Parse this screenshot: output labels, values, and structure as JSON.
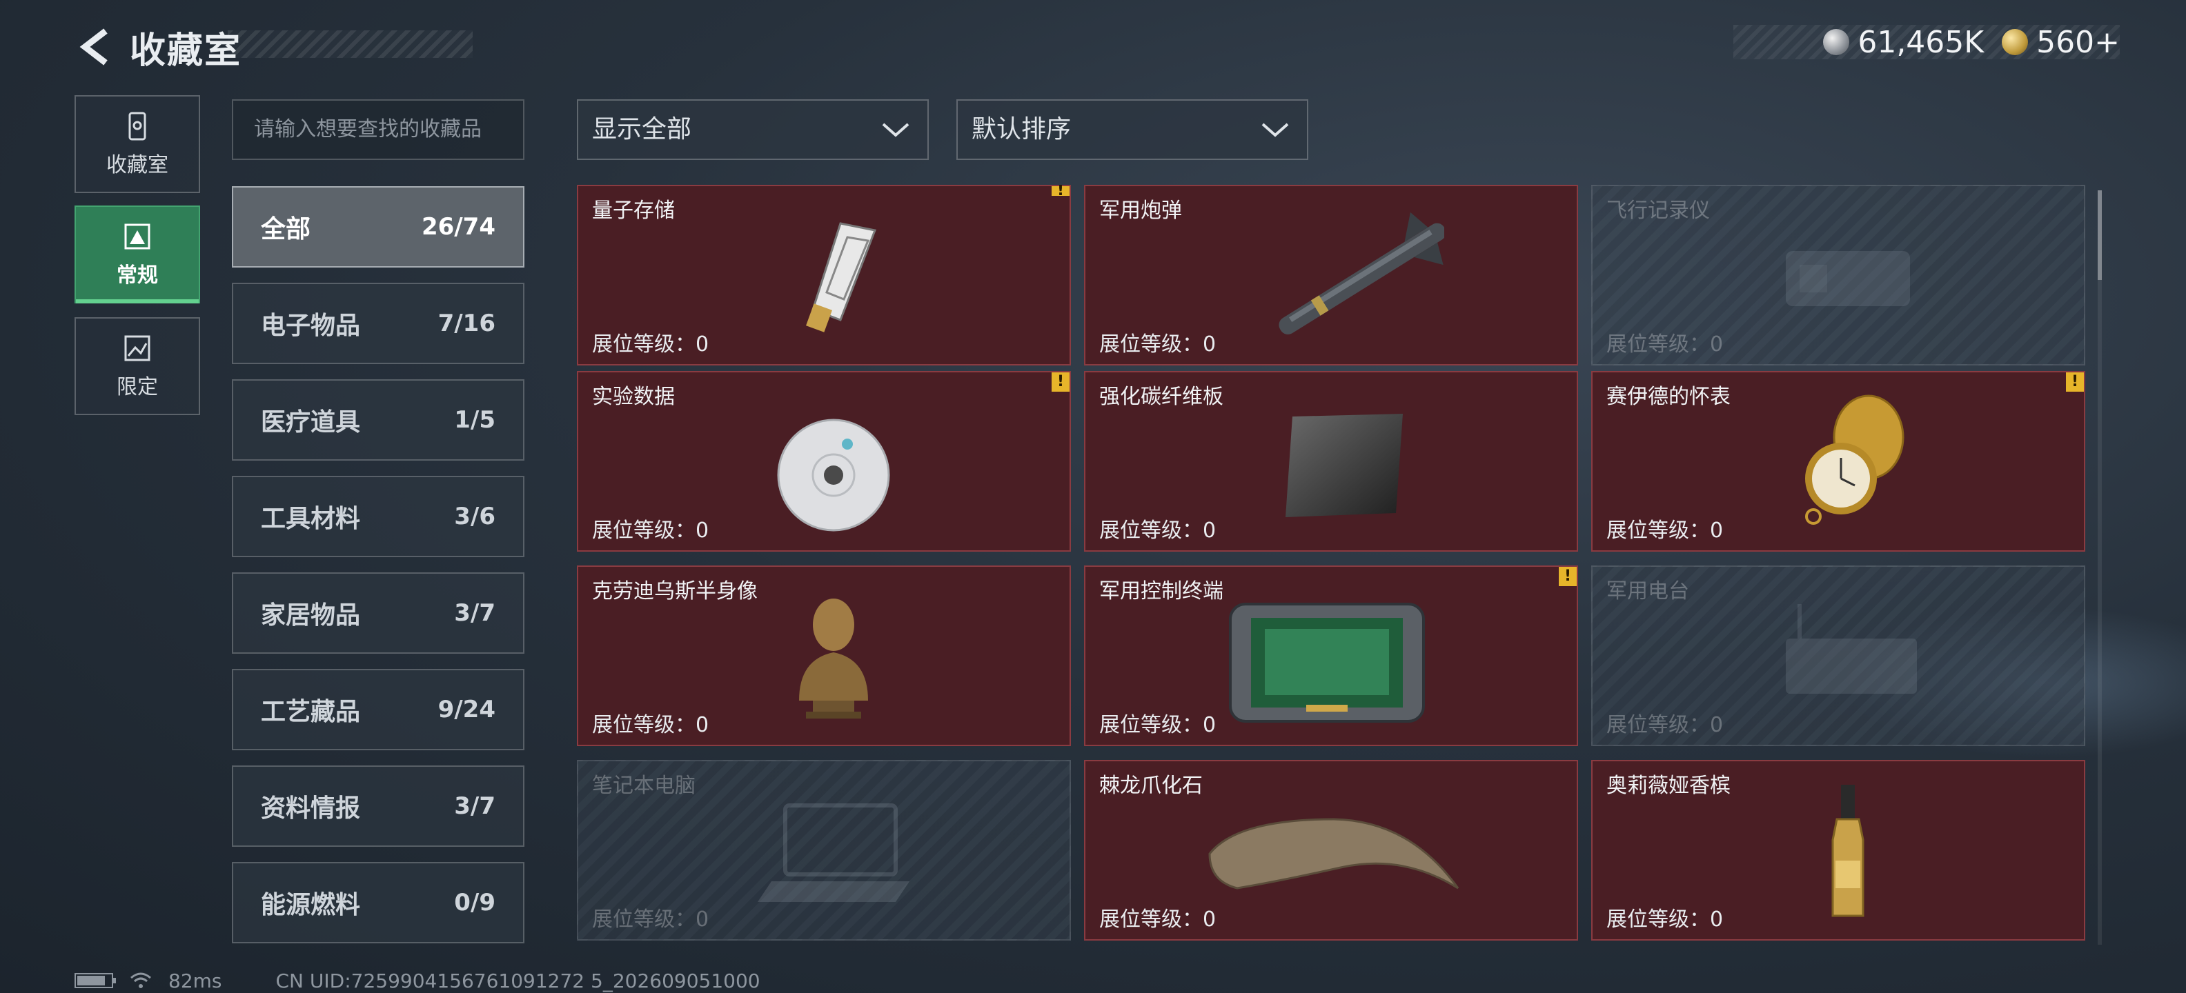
{
  "header": {
    "title": "收藏室",
    "currency_silver": "61,465K",
    "currency_gold": "560+"
  },
  "nav": [
    {
      "label": "收藏室",
      "icon": "collection-room-icon"
    },
    {
      "label": "常规",
      "icon": "regular-icon",
      "active": true
    },
    {
      "label": "限定",
      "icon": "limited-icon"
    }
  ],
  "search": {
    "placeholder": "请输入想要查找的收藏品"
  },
  "categories": [
    {
      "name": "全部",
      "count": "26/74",
      "active": true
    },
    {
      "name": "电子物品",
      "count": "7/16"
    },
    {
      "name": "医疗道具",
      "count": "1/5"
    },
    {
      "name": "工具材料",
      "count": "3/6"
    },
    {
      "name": "家居物品",
      "count": "3/7"
    },
    {
      "name": "工艺藏品",
      "count": "9/24"
    },
    {
      "name": "资料情报",
      "count": "3/7"
    },
    {
      "name": "能源燃料",
      "count": "0/9"
    }
  ],
  "filters": {
    "show": "显示全部",
    "sort": "默认排序"
  },
  "items": [
    {
      "name": "量子存储",
      "level": "展位等级：0",
      "collected": true,
      "warn": true
    },
    {
      "name": "军用炮弹",
      "level": "展位等级：0",
      "collected": true,
      "warn": false
    },
    {
      "name": "飞行记录仪",
      "level": "展位等级：0",
      "collected": false,
      "warn": false
    },
    {
      "name": "实验数据",
      "level": "展位等级：0",
      "collected": true,
      "warn": true
    },
    {
      "name": "强化碳纤维板",
      "level": "展位等级：0",
      "collected": true,
      "warn": false
    },
    {
      "name": "赛伊德的怀表",
      "level": "展位等级：0",
      "collected": true,
      "warn": true
    },
    {
      "name": "克劳迪乌斯半身像",
      "level": "展位等级：0",
      "collected": true,
      "warn": false
    },
    {
      "name": "军用控制终端",
      "level": "展位等级：0",
      "collected": true,
      "warn": true
    },
    {
      "name": "军用电台",
      "level": "展位等级：0",
      "collected": false,
      "warn": false
    },
    {
      "name": "笔记本电脑",
      "level": "展位等级：0",
      "collected": false,
      "warn": false
    },
    {
      "name": "棘龙爪化石",
      "level": "展位等级：0",
      "collected": true,
      "warn": false
    },
    {
      "name": "奥莉薇娅香槟",
      "level": "展位等级：0",
      "collected": true,
      "warn": false
    }
  ],
  "warn_mark": "!",
  "footer": {
    "ping": "82ms",
    "uid": "CN UID:7259904156761091272 5_202609051000"
  }
}
